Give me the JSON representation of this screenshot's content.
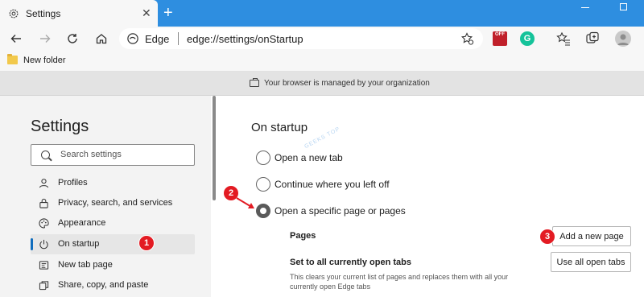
{
  "tab": {
    "title": "Settings",
    "close": "✕",
    "new_tab": "+"
  },
  "address": {
    "site": "Edge",
    "url": "edge://settings/onStartup"
  },
  "extensions": {
    "off_badge": "OFF",
    "grammarly": "G"
  },
  "favorites": {
    "folder": "New folder"
  },
  "banner": {
    "text": "Your browser is managed by your organization"
  },
  "sidebar": {
    "title": "Settings",
    "search_placeholder": "Search settings",
    "items": [
      {
        "label": "Profiles",
        "icon": "person-icon"
      },
      {
        "label": "Privacy, search, and services",
        "icon": "lock-icon"
      },
      {
        "label": "Appearance",
        "icon": "palette-icon"
      },
      {
        "label": "On startup",
        "icon": "power-icon"
      },
      {
        "label": "New tab page",
        "icon": "new-tab-icon"
      },
      {
        "label": "Share, copy, and paste",
        "icon": "share-icon"
      }
    ],
    "active_index": 3
  },
  "content": {
    "title": "On startup",
    "options": [
      {
        "label": "Open a new tab",
        "checked": false
      },
      {
        "label": "Continue where you left off",
        "checked": false
      },
      {
        "label": "Open a specific page or pages",
        "checked": true
      }
    ],
    "pages_label": "Pages",
    "add_page_button": "Add a new page",
    "set_tabs_label": "Set to all currently open tabs",
    "set_tabs_desc": "This clears your current list of pages and replaces them with all your currently open Edge tabs",
    "use_open_tabs_button": "Use all open tabs"
  },
  "annotations": {
    "step1": "1",
    "step2": "2",
    "step3": "3"
  },
  "colors": {
    "accent": "#0f6cbd",
    "tabstrip": "#2e8ee0",
    "marker": "#e31b23"
  }
}
